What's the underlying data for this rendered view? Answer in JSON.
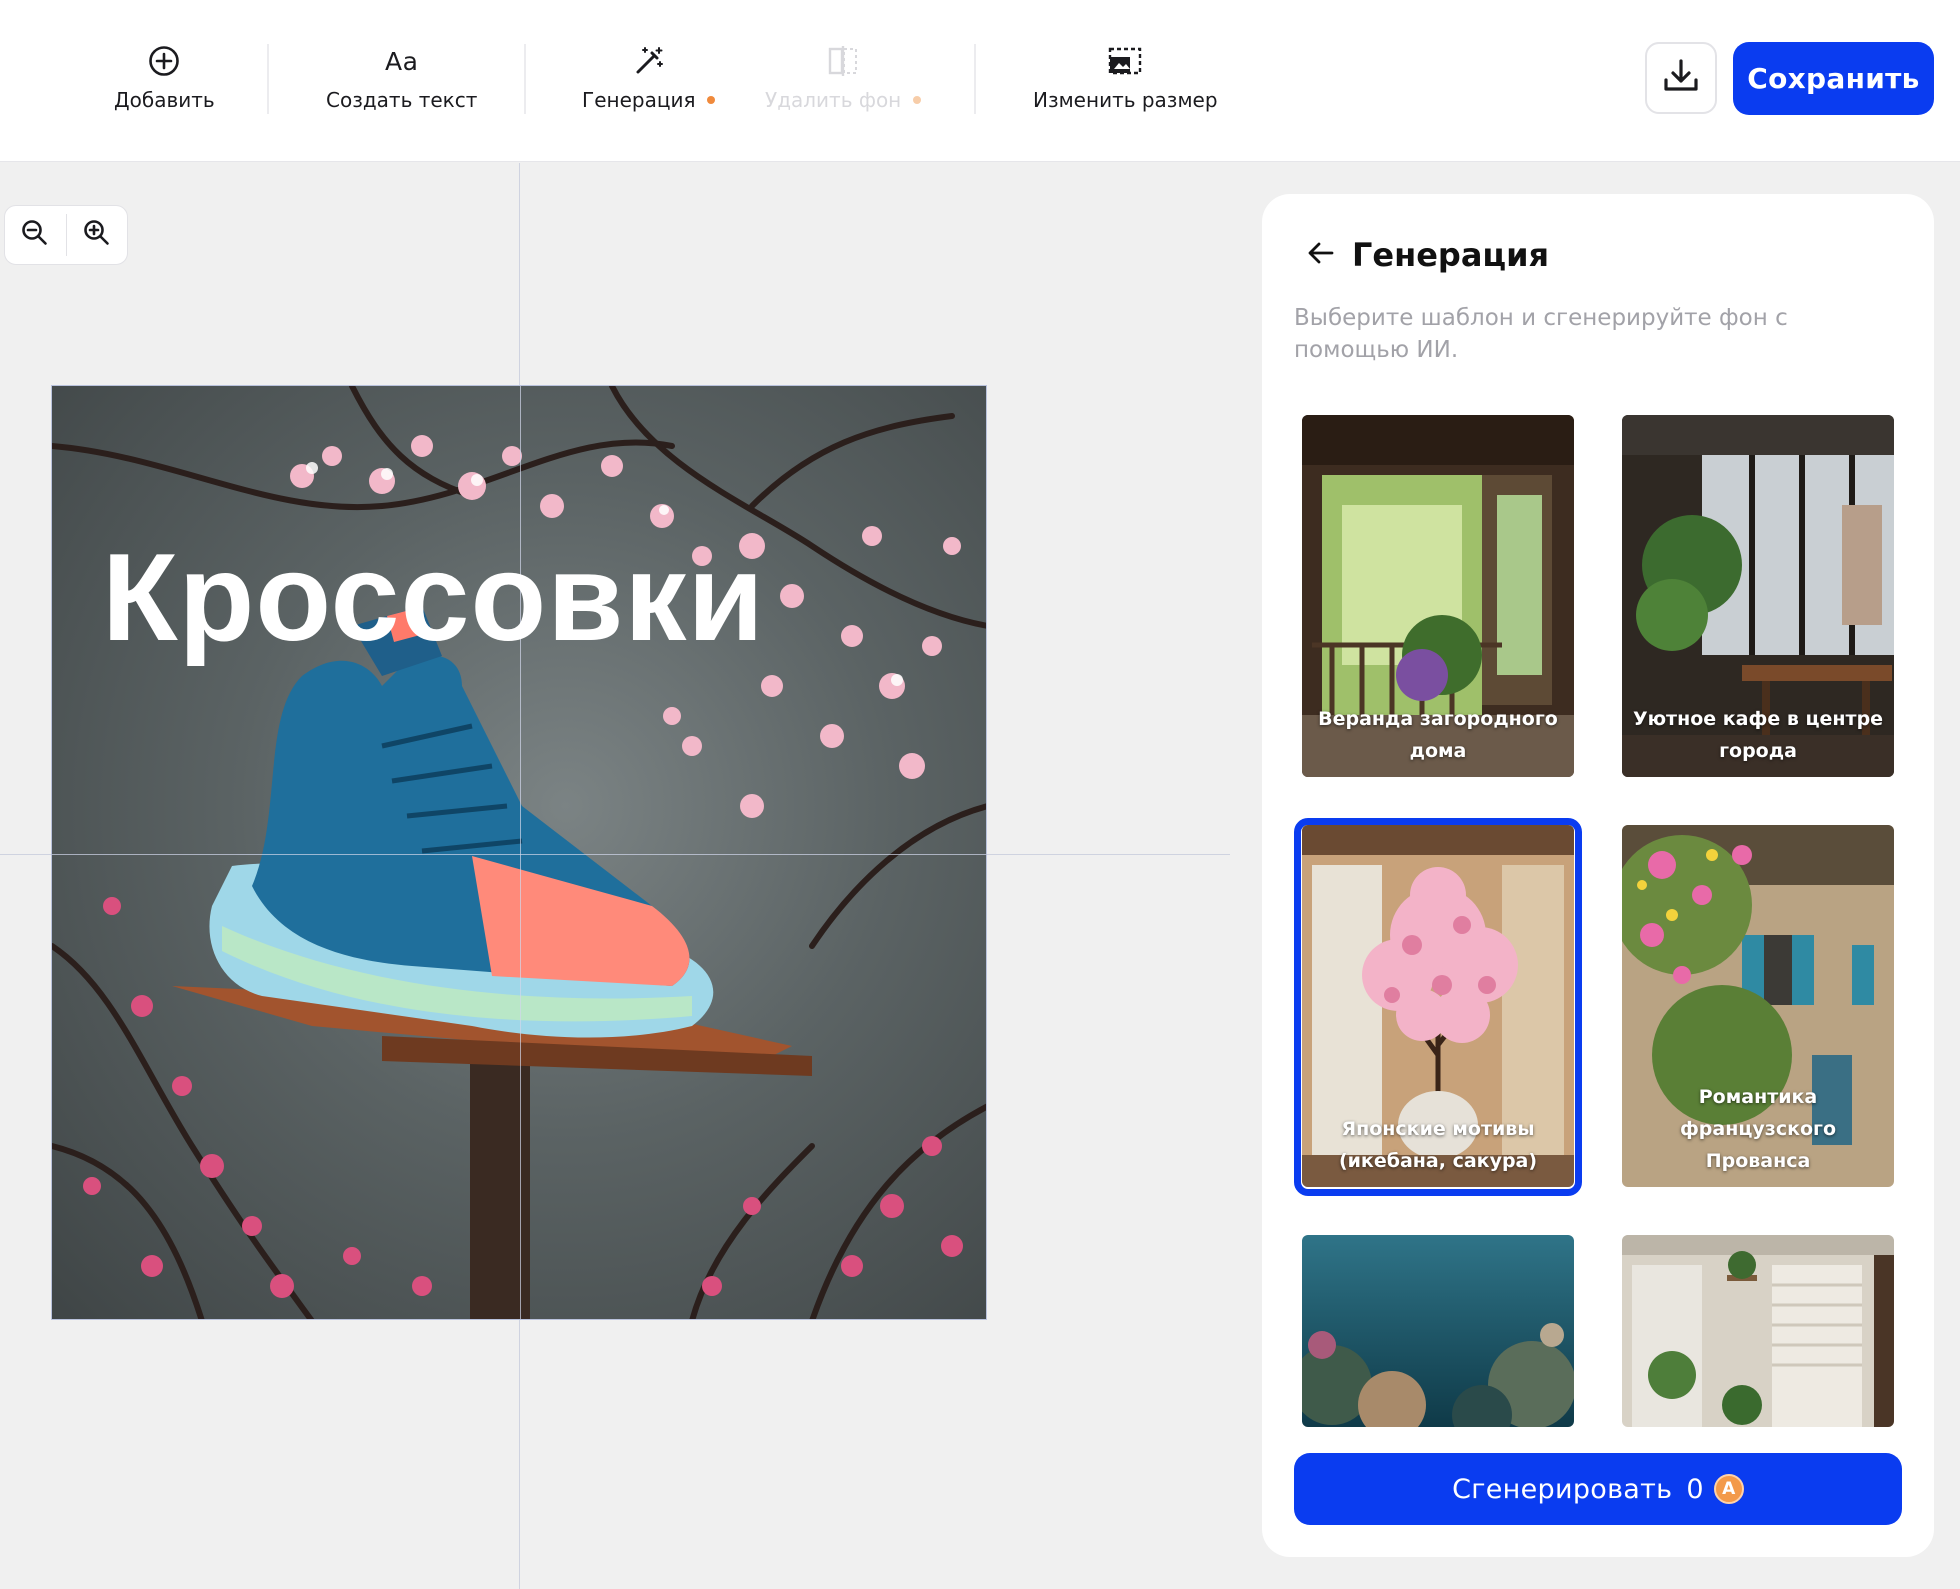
{
  "toolbar": {
    "tools": [
      {
        "label": "Добавить",
        "icon": "plus-circle-icon"
      },
      {
        "label": "Создать текст",
        "icon_text": "Aa"
      },
      {
        "label": "Генерация",
        "icon": "magic-wand-icon",
        "badge": "dot"
      },
      {
        "label": "Удалить фон",
        "icon": "remove-bg-icon",
        "disabled": true,
        "badge": "dot"
      },
      {
        "label": "Изменить размер",
        "icon": "resize-icon"
      }
    ],
    "download_icon": "download-icon",
    "save_label": "Сохранить"
  },
  "zoom": {
    "out_icon": "zoom-out-icon",
    "in_icon": "zoom-in-icon"
  },
  "canvas": {
    "title": "Кроссовки"
  },
  "panel": {
    "back_icon": "arrow-left-icon",
    "title": "Генерация",
    "description": "Выберите шаблон и сгенерируйте фон с помощью ИИ.",
    "templates": [
      {
        "caption": "Веранда загородного дома"
      },
      {
        "caption": "Уютное кафе в центре города"
      },
      {
        "caption": "Японские мотивы (икебана, сакура)",
        "selected": true
      },
      {
        "caption": "Романтика французского Прованса"
      },
      {
        "caption": ""
      },
      {
        "caption": ""
      }
    ],
    "generate": {
      "label": "Сгенерировать",
      "count": "0",
      "coin_letter": "A"
    }
  },
  "colors": {
    "accent": "#0a3cf0",
    "badge": "#f08a3c",
    "panel_bg": "#ffffff",
    "canvas_bg": "#f0f0f0"
  }
}
